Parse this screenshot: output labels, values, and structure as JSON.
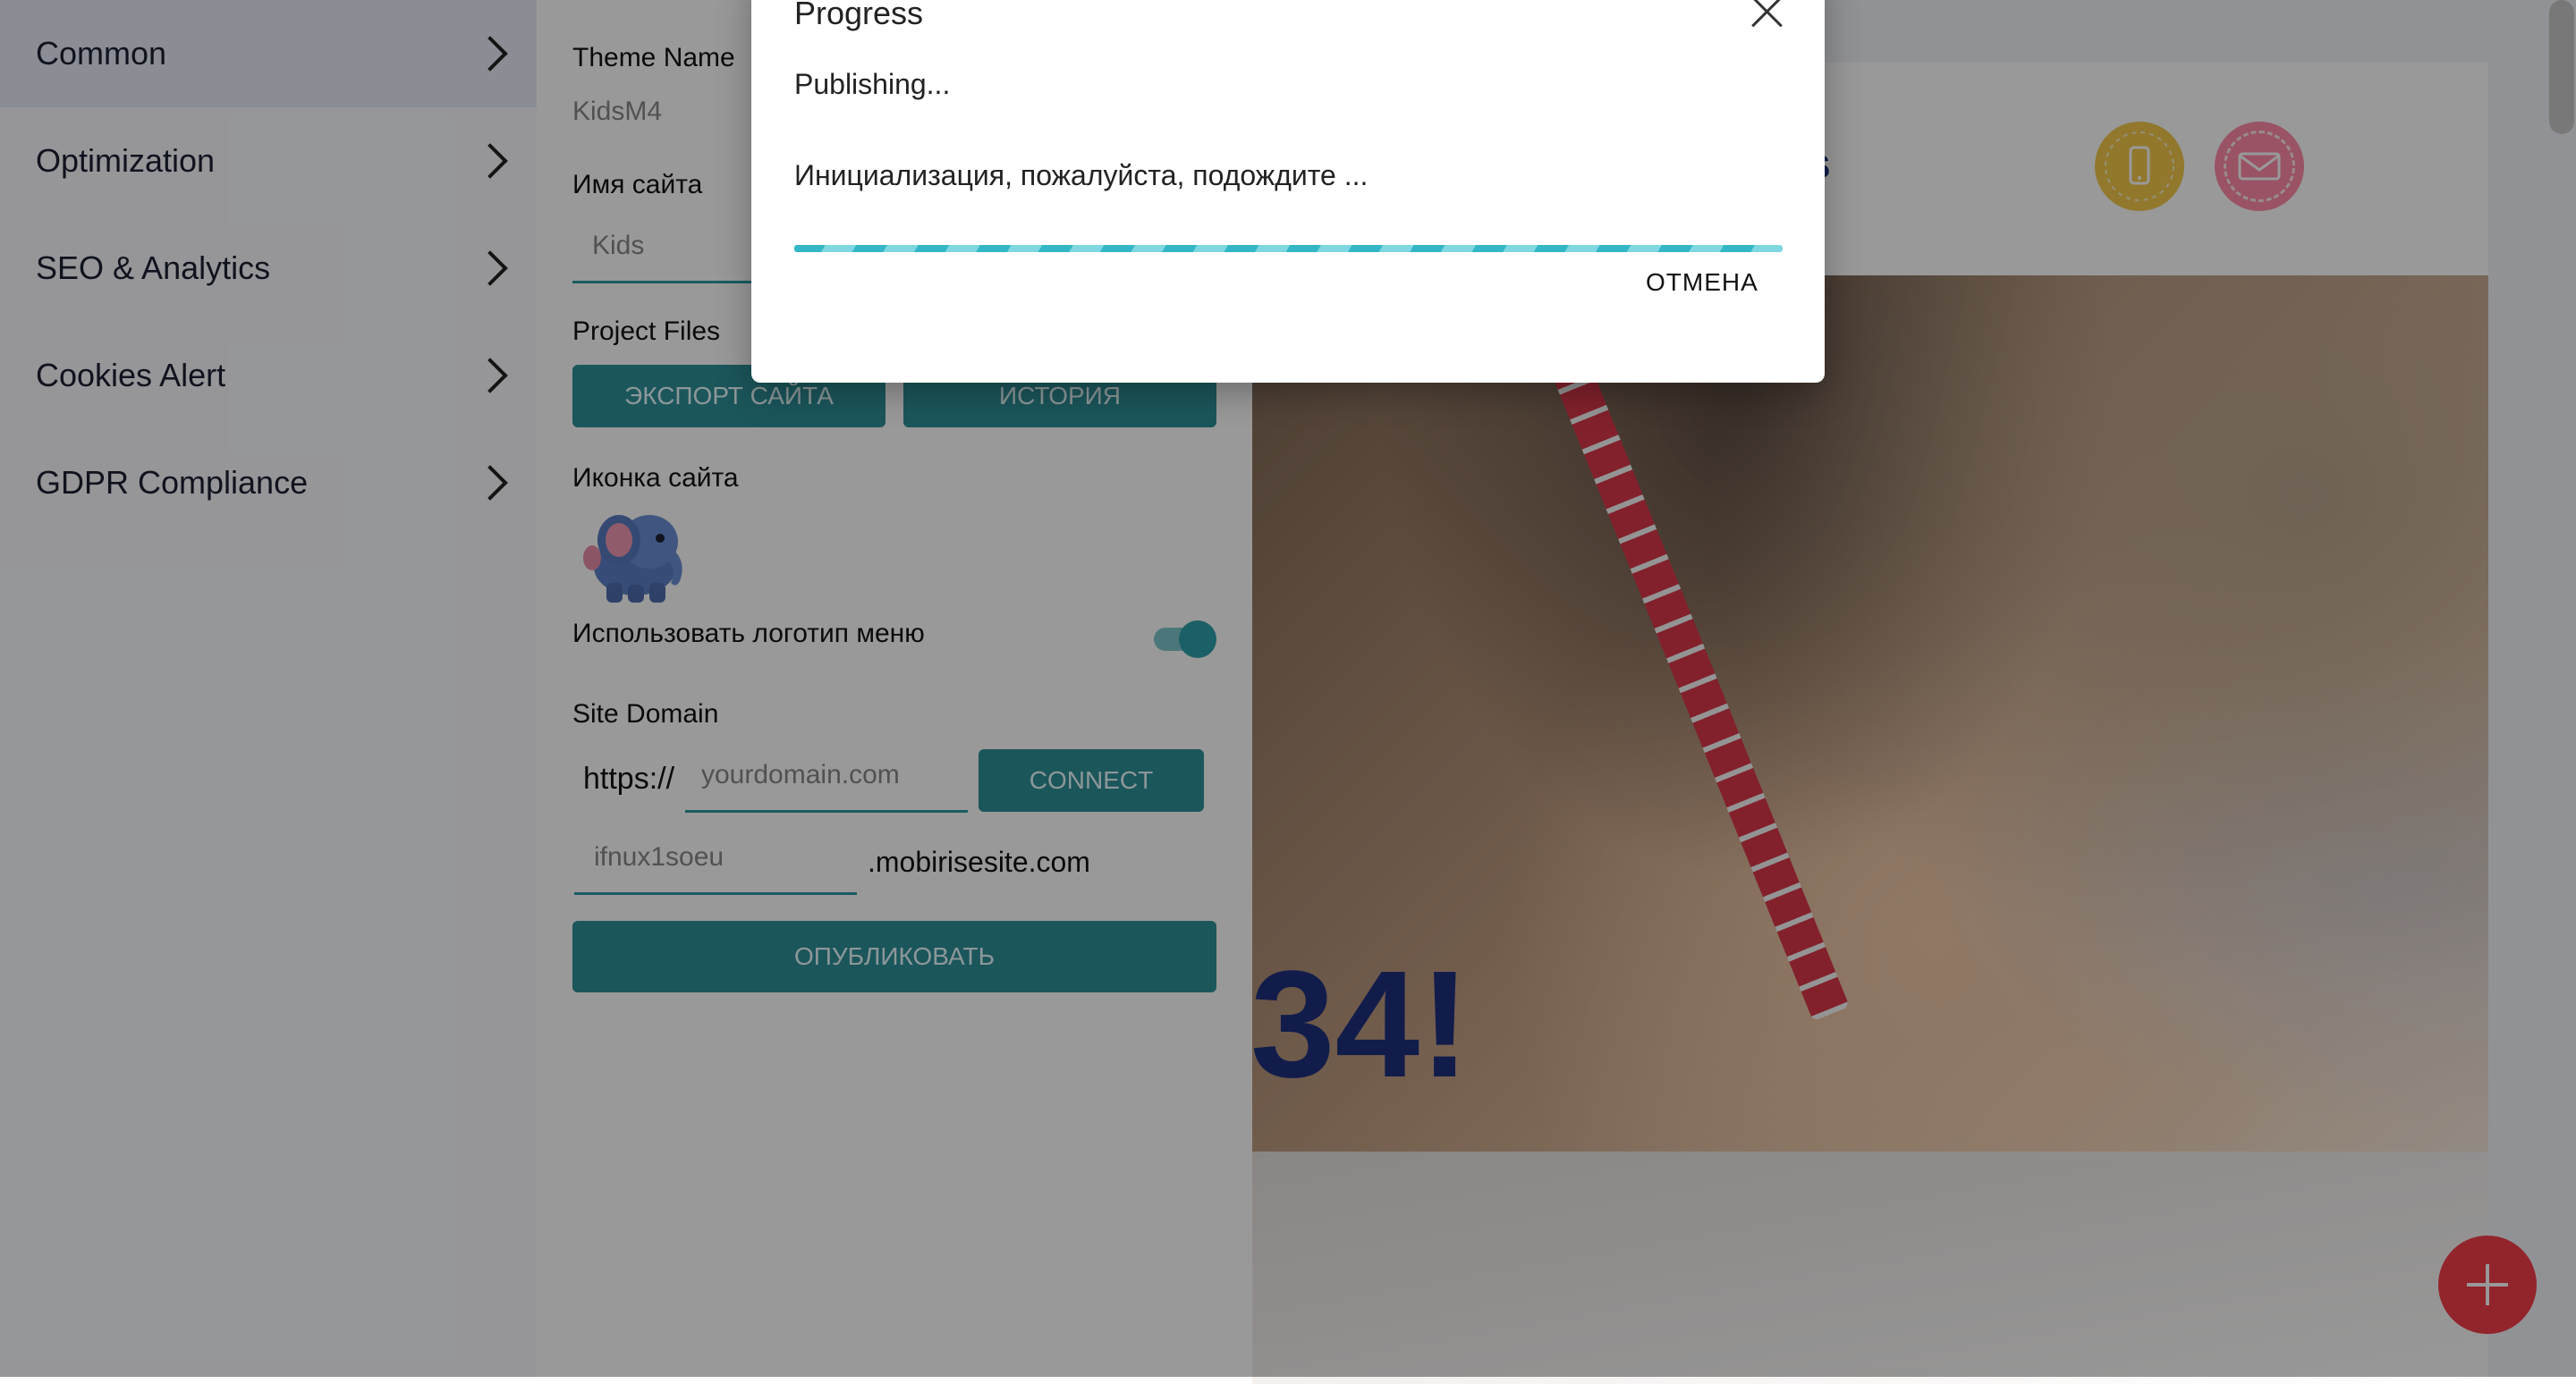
{
  "nav": {
    "items": [
      {
        "label": "Common"
      },
      {
        "label": "Optimization"
      },
      {
        "label": "SEO & Analytics"
      },
      {
        "label": "Cookies Alert"
      },
      {
        "label": "GDPR Compliance"
      }
    ]
  },
  "settings": {
    "theme_name_label": "Theme Name",
    "theme_name_value": "KidsM4",
    "site_name_label": "Имя сайта",
    "site_name_value": "Kids",
    "project_files_label": "Project Files",
    "export_button": "ЭКСПОРТ САЙТА",
    "history_button": "ИСТОРИЯ",
    "site_icon_label": "Иконка сайта",
    "use_menu_logo_label": "Использовать логотип меню",
    "use_menu_logo_on": true,
    "site_domain_label": "Site Domain",
    "domain_prefix": "https://",
    "domain_placeholder": "yourdomain.com",
    "connect_button": "CONNECT",
    "subdomain_value": "ifnux1soeu",
    "subdomain_suffix": ".mobirisesite.com",
    "publish_button": "ОПУБЛИКОВАТЬ"
  },
  "preview": {
    "brand_fragment": "s",
    "hero_fragment": "34!"
  },
  "dialog": {
    "title": "Progress",
    "status": "Publishing...",
    "message": "Инициализация, пожалуйста, подождите ...",
    "progress": 1.0,
    "cancel_button": "ОТМЕНА"
  },
  "colors": {
    "accent": "#2e8f98",
    "brand": "#1e2f7e",
    "fab": "#f43c4a",
    "progress": "#2aa5b2"
  },
  "icons": [
    "chevron-right-icon",
    "elephant-logo-icon",
    "phone-icon",
    "mail-icon",
    "close-icon",
    "plus-icon"
  ]
}
